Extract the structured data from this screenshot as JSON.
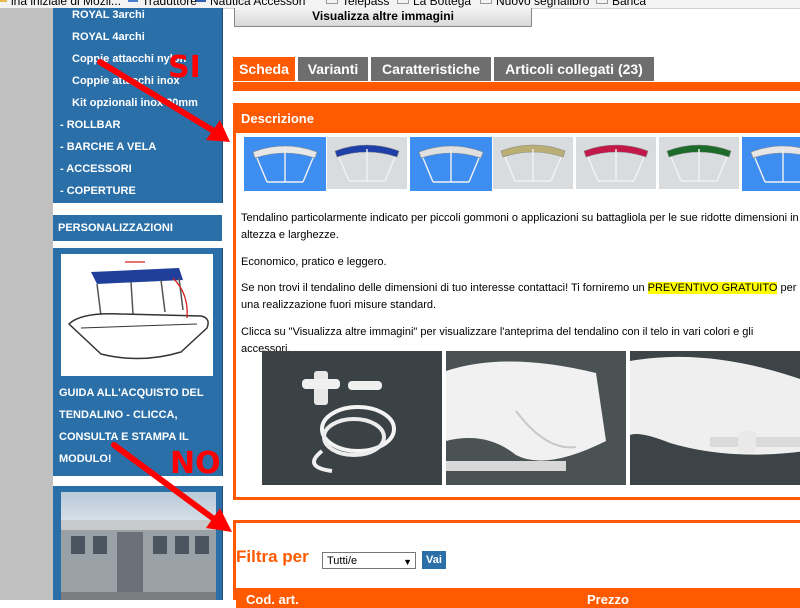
{
  "bookmarks": [
    {
      "label": "ina iniziale di Mozil...",
      "icon": "page-icon"
    },
    {
      "label": "Traduttore",
      "icon": "page-icon"
    },
    {
      "label": "Nautica Accessori",
      "icon": "page-icon"
    },
    {
      "label": "Telepass",
      "icon": "page-icon"
    },
    {
      "label": "La Bottega",
      "icon": "page-icon"
    },
    {
      "label": "Nuovo segnalibro",
      "icon": "page-icon"
    },
    {
      "label": "Banca",
      "icon": "page-icon"
    }
  ],
  "sidebar": {
    "sub_items": [
      "ROYAL 3archi",
      "ROYAL 4archi",
      "Coppie attacchi nylon",
      "Coppie attacchi inox",
      "Kit opzionali inox 20mm"
    ],
    "main_items": [
      "- ROLLBAR",
      "- BARCHE A VELA",
      "- ACCESSORI",
      "- COPERTURE"
    ],
    "personalization": "PERSONALIZZAZIONI",
    "guide_text": "GUIDA ALL'ACQUISTO DEL TENDALINO - CLICCA, CONSULTA E STAMPA IL MODULO!"
  },
  "main": {
    "more_images_button": "Visualizza altre immagini",
    "tabs": [
      {
        "label": "Scheda",
        "active": true
      },
      {
        "label": "Varianti",
        "active": false
      },
      {
        "label": "Caratteristiche",
        "active": false
      },
      {
        "label": "Articoli collegati (23)",
        "active": false
      }
    ],
    "description_title": "Descrizione",
    "thumbnails": [
      {
        "color": "#e8e8e8",
        "selected": true
      },
      {
        "color": "#1f3fa8",
        "selected": false
      },
      {
        "color": "#e0e0e0",
        "selected": true
      },
      {
        "color": "#b9ae73",
        "selected": false
      },
      {
        "color": "#c2184a",
        "selected": false
      },
      {
        "color": "#1d6b2a",
        "selected": false
      },
      {
        "color": "#e6e6e6",
        "selected": true
      }
    ],
    "paragraph1": "Tendalino particolarmente indicato per piccoli gommoni o applicazioni su battagliola per le sue ridotte dimensioni in altezza e larghezze.",
    "paragraph2": "Economico, pratico e leggero.",
    "paragraph3_before": "Se non trovi il tendalino delle dimensioni di tuo interesse contattaci! Ti forniremo un ",
    "paragraph3_highlight": "PREVENTIVO GRATUITO",
    "paragraph3_after": " per una realizzazione fuori misure standard.",
    "paragraph4": "Clicca su \"Visualizza altre immagini\" per visualizzare l'anteprima del tendalino con il telo in vari colori e gli accessori.",
    "filter_label": "Filtra per",
    "filter_value": "Tutti/e",
    "go_button": "Vai",
    "table_headers": [
      "Cod. art.",
      "Prezzo"
    ]
  },
  "annotations": {
    "yes_label": "SI",
    "no_label": "NO",
    "color": "#ff0000"
  }
}
